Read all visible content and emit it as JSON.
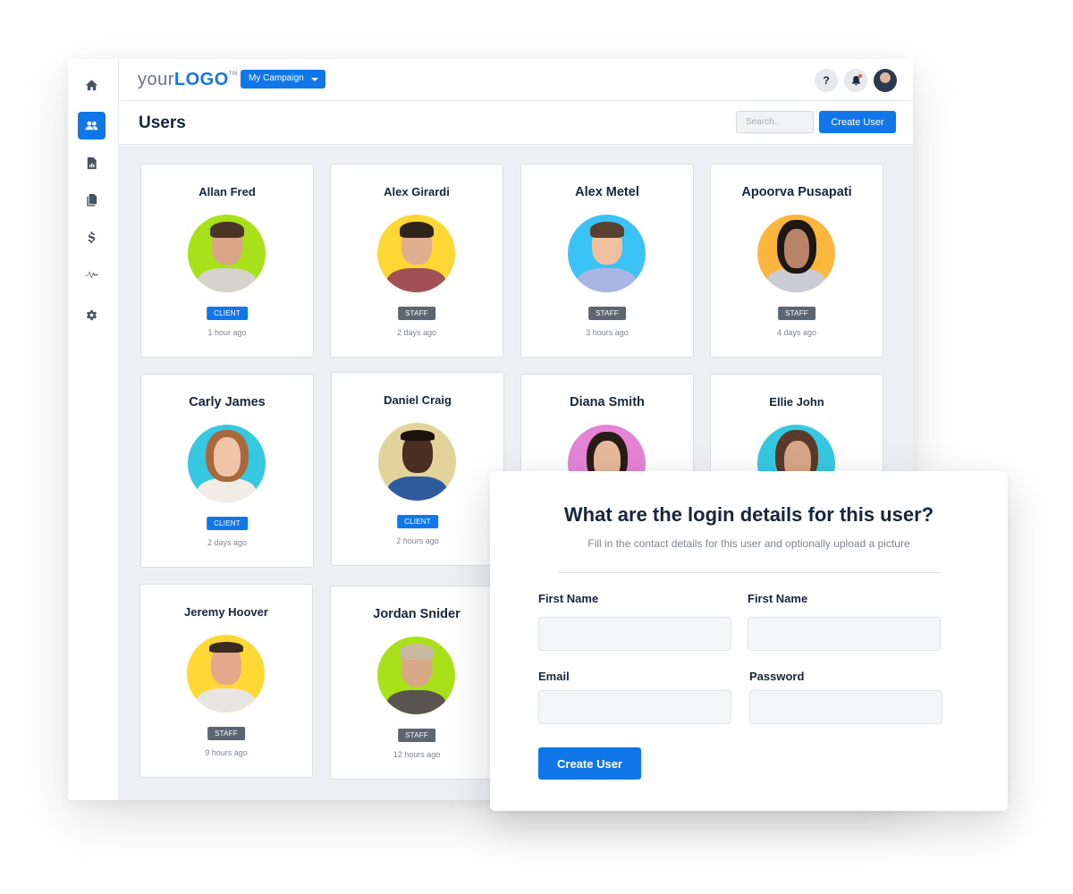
{
  "header": {
    "logo_prefix": "your",
    "logo_brand": "LOGO",
    "logo_tm": "TM",
    "campaign_selector": "My Campaign",
    "help_label": "?",
    "colors": {
      "accent": "#1177e8",
      "notification_dot": "#e8643c"
    }
  },
  "sidebar": {
    "items": [
      {
        "icon": "home-icon",
        "active": false
      },
      {
        "icon": "users-icon",
        "active": true
      },
      {
        "icon": "report-icon",
        "active": false
      },
      {
        "icon": "documents-icon",
        "active": false
      },
      {
        "icon": "dollar-icon",
        "active": false
      },
      {
        "icon": "activity-icon",
        "active": false
      },
      {
        "icon": "gear-icon",
        "active": false
      }
    ]
  },
  "page": {
    "title": "Users",
    "search_placeholder": "Search..",
    "create_button": "Create User"
  },
  "users": [
    {
      "name": "Allan Fred",
      "role": "CLIENT",
      "last_seen": "1 hour ago",
      "avatar_bg": "#a8e01a"
    },
    {
      "name": "Alex Girardi",
      "role": "STAFF",
      "last_seen": "2 days ago",
      "avatar_bg": "#fdd835"
    },
    {
      "name": "Alex Metel",
      "role": "STAFF",
      "last_seen": "3 hours ago",
      "avatar_bg": "#3cc3f5"
    },
    {
      "name": "Apoorva Pusapati",
      "role": "STAFF",
      "last_seen": "4 days ago",
      "avatar_bg": "#fbb63d"
    },
    {
      "name": "Carly James",
      "role": "CLIENT",
      "last_seen": "2 days ago",
      "avatar_bg": "#36c8e0"
    },
    {
      "name": "Daniel Craig",
      "role": "CLIENT",
      "last_seen": "2 hours ago",
      "avatar_bg": "#e2d39a"
    },
    {
      "name": "Diana Smith",
      "role": "",
      "last_seen": "",
      "avatar_bg": "#e584d6"
    },
    {
      "name": "Ellie John",
      "role": "",
      "last_seen": "",
      "avatar_bg": "#36c8e0"
    },
    {
      "name": "Jeremy Hoover",
      "role": "STAFF",
      "last_seen": "9 hours ago",
      "avatar_bg": "#fdd835"
    },
    {
      "name": "Jordan Snider",
      "role": "STAFF",
      "last_seen": "12 hours ago",
      "avatar_bg": "#a8e01a"
    }
  ],
  "modal": {
    "title": "What are the login details for this user?",
    "subtitle": "Fill in the contact details for this user and optionally upload a picture",
    "fields": [
      {
        "label": "First Name",
        "value": "",
        "placeholder": ""
      },
      {
        "label": "First Name",
        "value": "",
        "placeholder": ""
      },
      {
        "label": "Email",
        "value": "",
        "placeholder": ""
      },
      {
        "label": "Password",
        "value": "",
        "placeholder": ""
      }
    ],
    "submit": "Create User"
  }
}
